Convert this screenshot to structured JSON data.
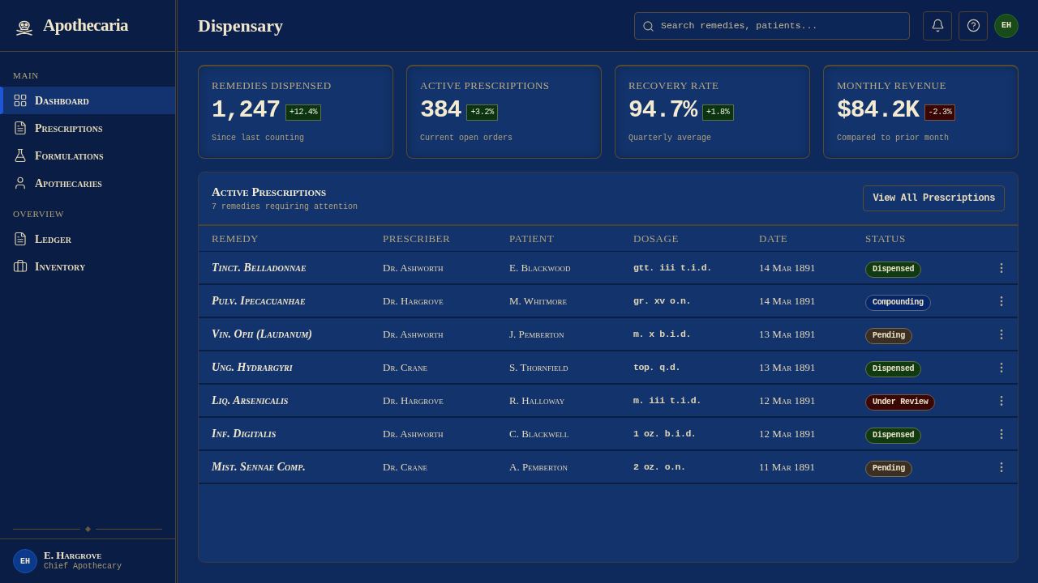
{
  "sidebar": {
    "brand": "Apothecaria",
    "sections": [
      {
        "title": "MAIN",
        "items": [
          {
            "label": "Dashboard",
            "selected": true
          },
          {
            "label": "Prescriptions",
            "selected": false
          },
          {
            "label": "Formulations",
            "selected": false
          },
          {
            "label": "Apothecaries",
            "selected": false
          }
        ]
      },
      {
        "title": "OVERVIEW",
        "items": [
          {
            "label": "Ledger",
            "selected": false
          },
          {
            "label": "Inventory",
            "selected": false
          }
        ]
      }
    ],
    "user": {
      "initials": "EH",
      "name": "E. Hargrove",
      "role": "Chief Apothecary"
    }
  },
  "header": {
    "title": "Dispensary",
    "search": {
      "placeholder": "Search remedies, patients..."
    },
    "avatar": "EH"
  },
  "stats": [
    {
      "label": "REMEDIES DISPENSED",
      "value": "1,247",
      "delta": {
        "text": "+12.4%",
        "color": "#0c3410"
      },
      "caption": "Since last counting"
    },
    {
      "label": "ACTIVE PRESCRIPTIONS",
      "value": "384",
      "delta": {
        "text": "+3.2%",
        "color": "#0c3410"
      },
      "caption": "Current open orders"
    },
    {
      "label": "RECOVERY RATE",
      "value": "94.7%",
      "delta": {
        "text": "+1.8%",
        "color": "#0c3410"
      },
      "caption": "Quarterly average"
    },
    {
      "label": "MONTHLY REVENUE",
      "value": "$84.2K",
      "delta": {
        "text": "-2.3%",
        "color": "#3a0505"
      },
      "caption": "Compared to prior month"
    }
  ],
  "prescriptions": {
    "title": "Active Prescriptions",
    "subtitle": "7 remedies requiring attention",
    "button": "View All Prescriptions",
    "columns": [
      "REMEDY",
      "PRESCRIBER",
      "PATIENT",
      "DOSAGE",
      "DATE",
      "STATUS"
    ],
    "rows": [
      {
        "remedy": "Tinct. Belladonnae",
        "prescriber": "Dr. Ashworth",
        "patient": "E. Blackwood",
        "dosage": "gtt. iii t.i.d.",
        "date": "14 Mar 1891",
        "status": {
          "label": "Dispensed",
          "color": "#0f3a12"
        }
      },
      {
        "remedy": "Pulv. Ipecacuanhae",
        "prescriber": "Dr. Hargrove",
        "patient": "M. Whitmore",
        "dosage": "gr. xv o.n.",
        "date": "14 Mar 1891",
        "status": {
          "label": "Compounding",
          "color": "#05266a"
        }
      },
      {
        "remedy": "Vin. Opii (Laudanum)",
        "prescriber": "Dr. Ashworth",
        "patient": "J. Pemberton",
        "dosage": "m. x b.i.d.",
        "date": "13 Mar 1891",
        "status": {
          "label": "Pending",
          "color": "#3a2f22"
        }
      },
      {
        "remedy": "Ung. Hydrargyri",
        "prescriber": "Dr. Crane",
        "patient": "S. Thornfield",
        "dosage": "top. q.d.",
        "date": "13 Mar 1891",
        "status": {
          "label": "Dispensed",
          "color": "#0f3a12"
        }
      },
      {
        "remedy": "Liq. Arsenicalis",
        "prescriber": "Dr. Hargrove",
        "patient": "R. Halloway",
        "dosage": "m. iii t.i.d.",
        "date": "12 Mar 1891",
        "status": {
          "label": "Under Review",
          "color": "#3a0707"
        }
      },
      {
        "remedy": "Inf. Digitalis",
        "prescriber": "Dr. Ashworth",
        "patient": "C. Blackwell",
        "dosage": "1 oz. b.i.d.",
        "date": "12 Mar 1891",
        "status": {
          "label": "Dispensed",
          "color": "#0f3a12"
        }
      },
      {
        "remedy": "Mist. Sennae Comp.",
        "prescriber": "Dr. Crane",
        "patient": "A. Pemberton",
        "dosage": "2 oz. o.n.",
        "date": "11 Mar 1891",
        "status": {
          "label": "Pending",
          "color": "#3a2f22"
        }
      }
    ]
  }
}
